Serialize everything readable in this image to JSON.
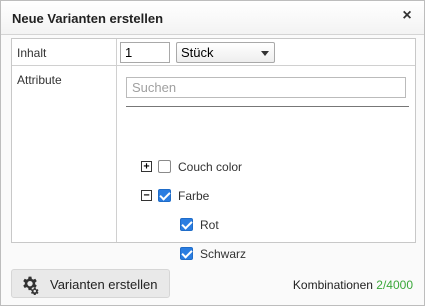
{
  "dialog": {
    "title": "Neue Varianten erstellen",
    "close_glyph": "×"
  },
  "inhalt": {
    "label": "Inhalt",
    "quantity": "1",
    "unit": "Stück"
  },
  "attribute": {
    "label": "Attribute",
    "search_placeholder": "Suchen",
    "items": [
      {
        "label": "Couch color",
        "expander": "+",
        "checked": false,
        "level": 0
      },
      {
        "label": "Farbe",
        "expander": "−",
        "checked": true,
        "level": 0
      },
      {
        "label": "Rot",
        "checked": true,
        "level": 1
      },
      {
        "label": "Schwarz",
        "checked": true,
        "level": 1
      }
    ]
  },
  "footer": {
    "create_button": "Varianten erstellen",
    "combinations_label": "Kombinationen",
    "combinations_count": "2/4000"
  },
  "colors": {
    "accent_checkbox": "#2a7de1",
    "count_green": "#3aa83a"
  },
  "icons": {
    "close": "close-icon",
    "gear": "gear-icon",
    "expand": "plus-box-icon",
    "collapse": "minus-box-icon",
    "dropdown": "chevron-down-icon"
  }
}
